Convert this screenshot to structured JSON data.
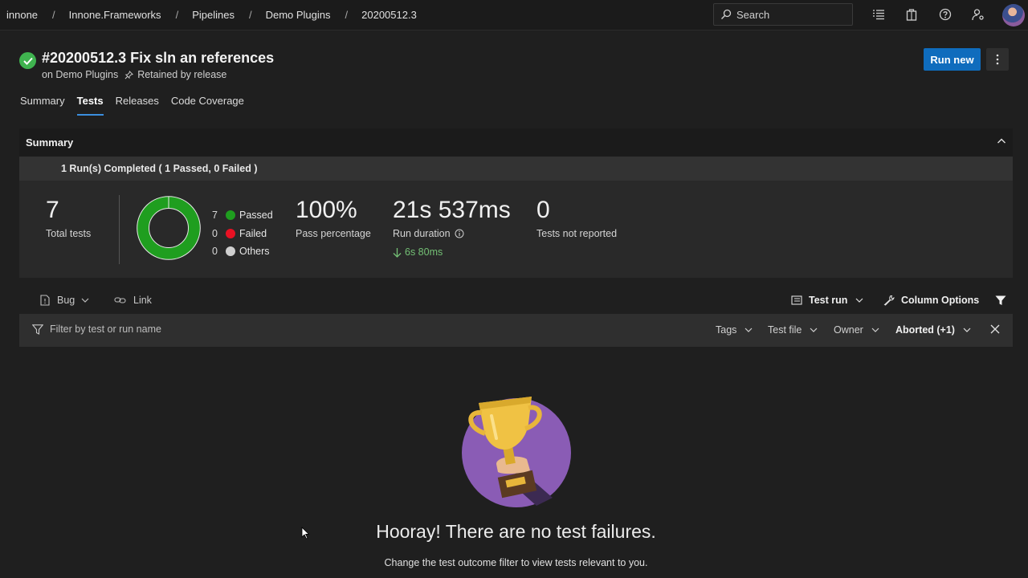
{
  "breadcrumbs": [
    "innone",
    "Innone.Frameworks",
    "Pipelines",
    "Demo Plugins",
    "20200512.3"
  ],
  "search": {
    "placeholder": "Search"
  },
  "header": {
    "title": "#20200512.3 Fix sln an references",
    "on_label": "on Demo Plugins",
    "retained_label": "Retained by release",
    "run_new_label": "Run new",
    "status_color": "#3fb34f"
  },
  "tabs": [
    {
      "label": "Summary",
      "active": false
    },
    {
      "label": "Tests",
      "active": true
    },
    {
      "label": "Releases",
      "active": false
    },
    {
      "label": "Code Coverage",
      "active": false
    }
  ],
  "summary": {
    "heading": "Summary",
    "runs_completed": "1 Run(s) Completed ( 1 Passed, 0 Failed )",
    "total_tests": "7",
    "total_tests_label": "Total tests",
    "legend": [
      {
        "count": "7",
        "label": "Passed",
        "color": "#1f9e1f"
      },
      {
        "count": "0",
        "label": "Failed",
        "color": "#e81123"
      },
      {
        "count": "0",
        "label": "Others",
        "color": "#cfcfcf"
      }
    ],
    "pass_percentage": "100%",
    "pass_percentage_label": "Pass percentage",
    "run_duration": "21s 537ms",
    "run_duration_label": "Run duration",
    "duration_delta": "6s 80ms",
    "not_reported": "0",
    "not_reported_label": "Tests not reported"
  },
  "toolbar": {
    "bug_label": "Bug",
    "link_label": "Link",
    "test_run_label": "Test run",
    "column_options_label": "Column Options"
  },
  "filter": {
    "placeholder": "Filter by test or run name",
    "tags_label": "Tags",
    "test_file_label": "Test file",
    "owner_label": "Owner",
    "outcome_label": "Aborted (+1)"
  },
  "empty_state": {
    "title": "Hooray! There are no test failures.",
    "subtitle": "Change the test outcome filter to view tests relevant to you."
  }
}
